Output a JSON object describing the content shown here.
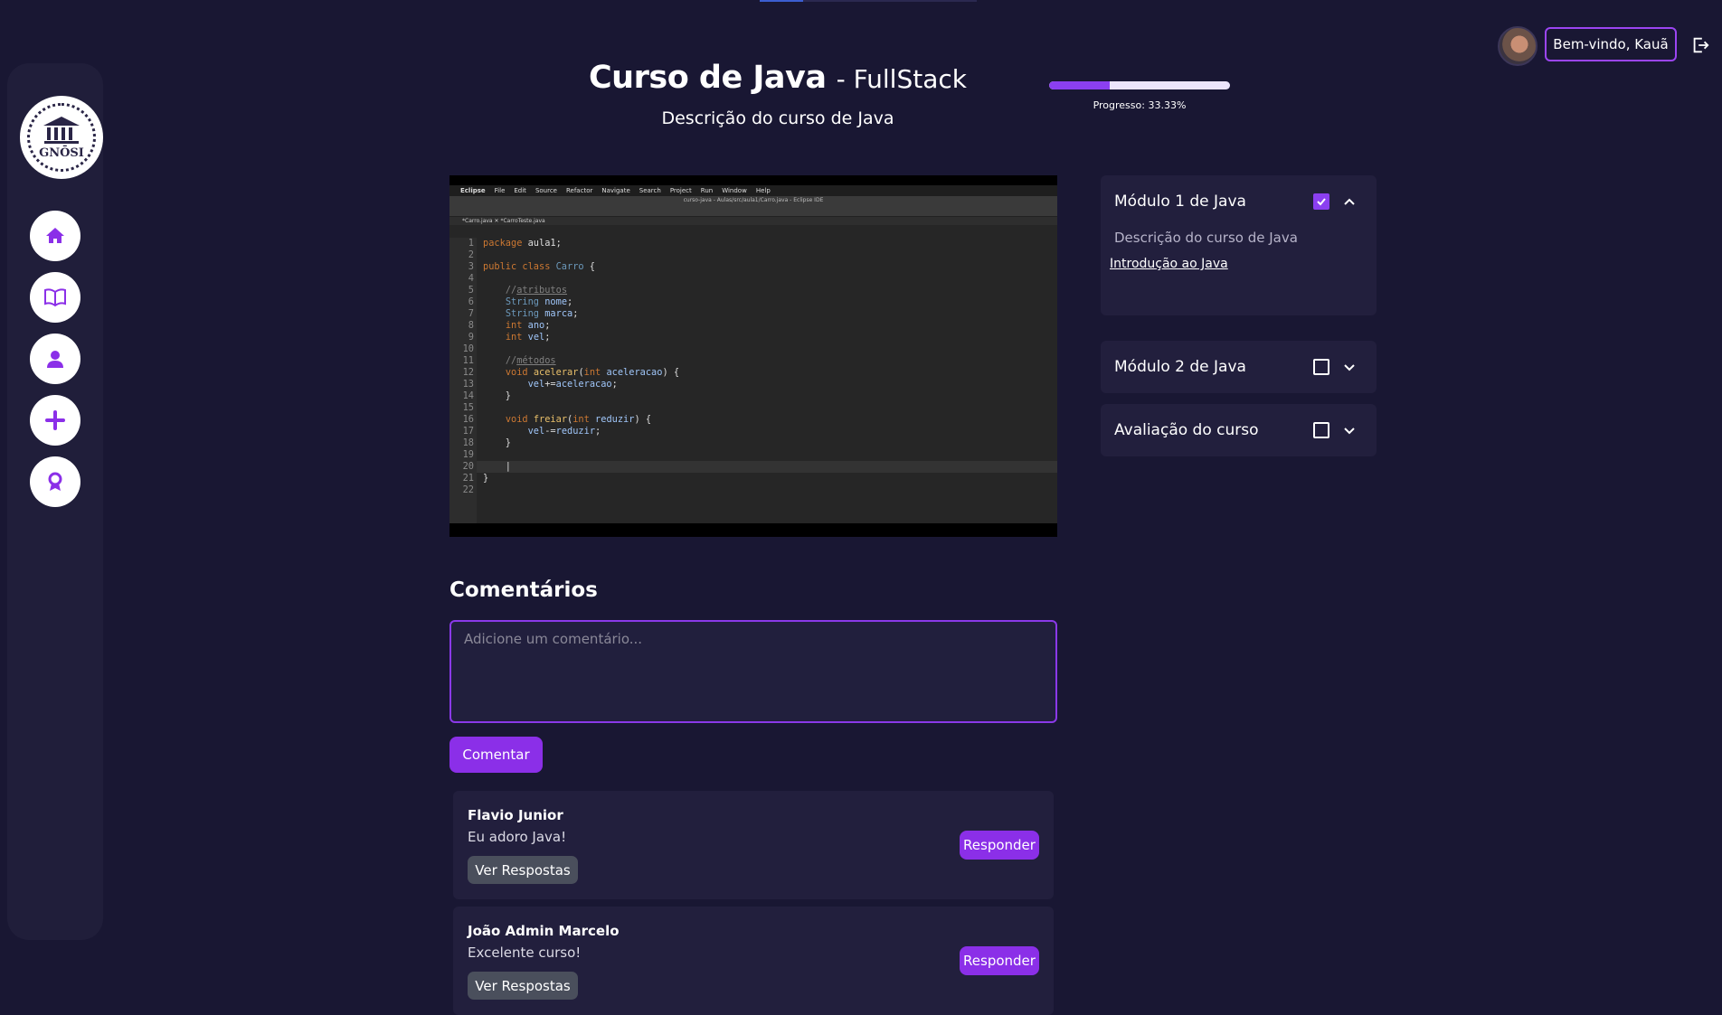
{
  "brand": {
    "logo_text": "GNŌSI"
  },
  "sidebar": {
    "items": [
      {
        "name": "home"
      },
      {
        "name": "courses"
      },
      {
        "name": "profile"
      },
      {
        "name": "add"
      },
      {
        "name": "certificates"
      }
    ]
  },
  "header": {
    "title": "Curso de Java",
    "subtitle": "- FullStack",
    "description": "Descrição do curso de Java",
    "progress_label": "Progresso: 33.33%",
    "progress_fraction": 0.3333
  },
  "user": {
    "welcome": "Bem-vindo, Kauã"
  },
  "video": {
    "menu": [
      "Eclipse",
      "File",
      "Edit",
      "Source",
      "Refactor",
      "Navigate",
      "Search",
      "Project",
      "Run",
      "Window",
      "Help"
    ],
    "window_title": "curso-java - Aulas/src/aula1/Carro.java - Eclipse IDE",
    "tabs": "*Carro.java ✕   *CarroTeste.java",
    "code_lines": [
      "package aula1;",
      "",
      "public class Carro {",
      "",
      "    //atributos",
      "    String nome;",
      "    String marca;",
      "    int ano;",
      "    int vel;",
      "",
      "    //métodos",
      "    void acelerar(int aceleracao) {",
      "        vel+=aceleracao;",
      "    }",
      "",
      "    void freiar(int reduzir) {",
      "        vel-=reduzir;",
      "    }",
      "",
      "    |",
      "}",
      ""
    ]
  },
  "modules": [
    {
      "title": "Módulo 1 de Java",
      "checked": true,
      "expanded": true,
      "description": "Descrição do curso de Java",
      "lessons": [
        "Introdução ao Java"
      ]
    },
    {
      "title": "Módulo 2 de Java",
      "checked": false,
      "expanded": false
    },
    {
      "title": "Avaliação do curso",
      "checked": false,
      "expanded": false
    }
  ],
  "comments_section": {
    "title": "Comentários",
    "placeholder": "Adicione um comentário...",
    "submit_label": "Comentar",
    "reply_label": "Responder",
    "view_replies_label": "Ver Respostas",
    "items": [
      {
        "author": "Flavio Junior",
        "text": "Eu adoro Java!"
      },
      {
        "author": "João Admin Marcelo",
        "text": "Excelente curso!"
      }
    ]
  },
  "colors": {
    "accent": "#8b2fe8",
    "background": "#191733",
    "panel": "#221f3d"
  }
}
